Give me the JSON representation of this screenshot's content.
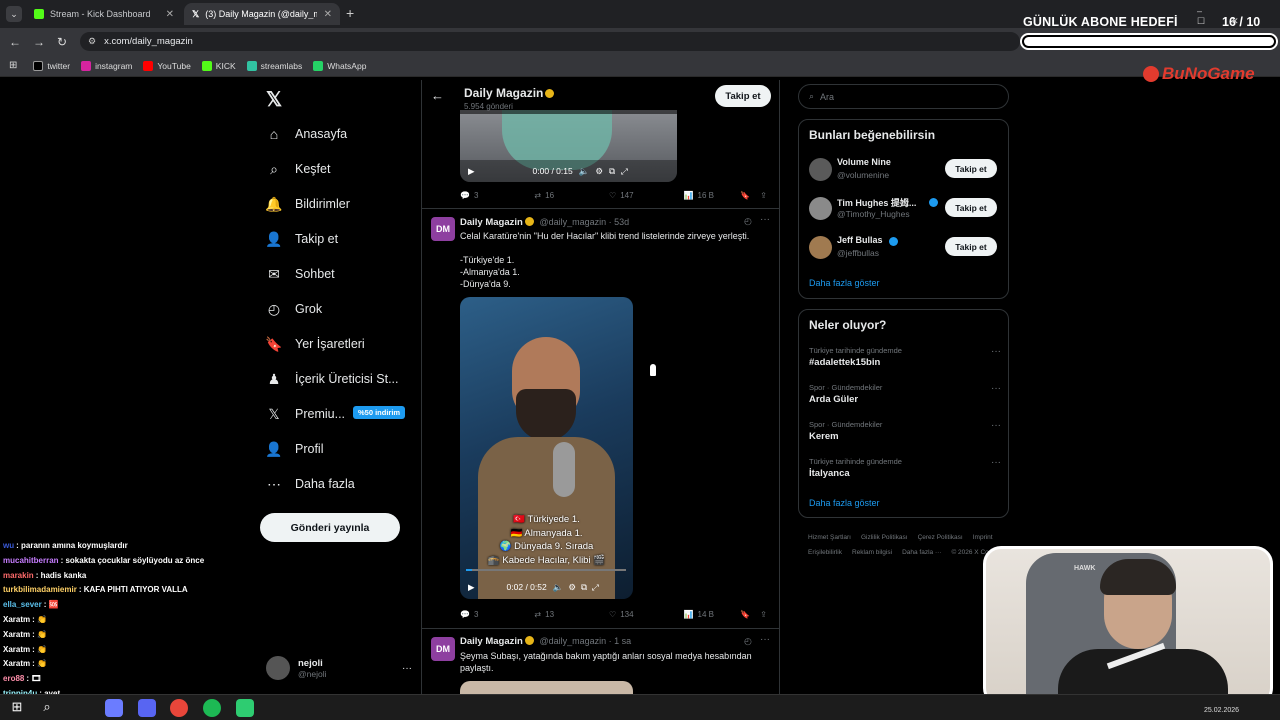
{
  "browser": {
    "tabs": [
      {
        "title": "Stream - Kick Dashboard",
        "close": "✕"
      },
      {
        "title": "(3) Daily Magazin (@daily_mag",
        "close": "✕"
      }
    ],
    "new_tab": "+",
    "url": "x.com/daily_magazin",
    "bookmarks": [
      {
        "label": "twitter",
        "color": "#000000"
      },
      {
        "label": "instagram",
        "color": "#d6249f"
      },
      {
        "label": "YouTube",
        "color": "#ff0000"
      },
      {
        "label": "KICK",
        "color": "#53fc18"
      },
      {
        "label": "streamlabs",
        "color": "#31c3a2"
      },
      {
        "label": "WhatsApp",
        "color": "#25d366"
      }
    ]
  },
  "overlay": {
    "goal_label": "GÜNLÜK ABONE HEDEFİ",
    "goal_current": "16",
    "goal_total": "/ 10",
    "brand": "BuNoGame"
  },
  "nav": {
    "items": [
      {
        "label": "Anasayfa",
        "icon": "home-icon",
        "glyph": "⌂"
      },
      {
        "label": "Keşfet",
        "icon": "search-icon",
        "glyph": "⌕"
      },
      {
        "label": "Bildirimler",
        "icon": "bell-icon",
        "glyph": "🔔"
      },
      {
        "label": "Takip et",
        "icon": "add-user-icon",
        "glyph": "👤"
      },
      {
        "label": "Sohbet",
        "icon": "mail-icon",
        "glyph": "✉"
      },
      {
        "label": "Grok",
        "icon": "grok-icon",
        "glyph": "◴"
      },
      {
        "label": "Yer İşaretleri",
        "icon": "bookmark-icon",
        "glyph": "🔖"
      },
      {
        "label": "İçerik Üreticisi St...",
        "icon": "creator-icon",
        "glyph": "♟"
      },
      {
        "label": "Premiu...",
        "icon": "x-premium-icon",
        "glyph": "𝕏"
      },
      {
        "label": "Profil",
        "icon": "profile-icon",
        "glyph": "👤"
      },
      {
        "label": "Daha fazla",
        "icon": "more-circle-icon",
        "glyph": "⋯"
      }
    ],
    "premium_badge": "%50 indirim",
    "post_button": "Gönderi yayınla",
    "account_name": "nejoli",
    "account_handle": "@nejoli",
    "account_more": "···"
  },
  "header": {
    "name": "Daily Magazin",
    "posts": "5.954 gönderi",
    "follow": "Takip et"
  },
  "tweet1": {
    "time": "0:00 / 0:15",
    "stats": {
      "replies": "3",
      "retweets": "16",
      "likes": "147",
      "views": "16 B"
    }
  },
  "tweet2": {
    "name": "Daily Magazin",
    "handle": "@daily_magazin · 53d",
    "text": "Celal Karatüre'nin \"Hu der Hacılar\" klibi trend listelerinde zirveye yerleşti.",
    "lines": [
      "-Türkiye'de 1.",
      "-Almanya'da 1.",
      "-Dünya'da 9."
    ],
    "video_caption": [
      "🇹🇷 Türkiyede 1.",
      "🇩🇪 Almanyada 1.",
      "🌍 Dünyada 9. Sırada",
      "🕋 Kabede Hacılar, Klibi 🎬"
    ],
    "time": "0:02 / 0:52",
    "stats": {
      "replies": "3",
      "retweets": "13",
      "likes": "134",
      "views": "14 B"
    }
  },
  "tweet3": {
    "name": "Daily Magazin",
    "handle": "@daily_magazin · 1 sa",
    "text": "Şeyma Subaşı, yatağında bakım yaptığı anları sosyal medya hesabından paylaştı."
  },
  "right": {
    "search_placeholder": "Ara",
    "suggest_title": "Bunları beğenebilirsin",
    "suggestions": [
      {
        "name": "Volume Nine",
        "handle": "@volumenine",
        "follow": "Takip et"
      },
      {
        "name": "Tim Hughes 提姆...",
        "handle": "@Timothy_Hughes",
        "follow": "Takip et"
      },
      {
        "name": "Jeff Bullas",
        "handle": "@jeffbullas",
        "follow": "Takip et"
      }
    ],
    "show_more": "Daha fazla göster",
    "trends_title": "Neler oluyor?",
    "trends": [
      {
        "meta": "Türkiye tarihinde gündemde",
        "name": "#adalettek15bin"
      },
      {
        "meta": "Spor · Gündemdekiler",
        "name": "Arda Güler"
      },
      {
        "meta": "Spor · Gündemdekiler",
        "name": "Kerem"
      },
      {
        "meta": "Türkiye tarihinde gündemde",
        "name": "İtalyanca"
      }
    ],
    "trends_more": "Daha fazla göster",
    "footer_links": [
      "Hizmet Şartları",
      "Gizlilik Politikası",
      "Çerez Politikası",
      "Imprint",
      "Erişilebilirlik",
      "Reklam bilgisi",
      "Daha fazla ···",
      "© 2026 X Corp."
    ]
  },
  "chat": [
    {
      "user": "wu",
      "color": "#3a5bd9",
      "msg": ": paranın amına koymuşlardır"
    },
    {
      "user": "mucahitberran",
      "color": "#c77dff",
      "msg": ": sokakta çocuklar söylüyodu az önce"
    },
    {
      "user": "marakin",
      "color": "#ff6b6b",
      "msg": ": hadis kanka"
    },
    {
      "user": "turkbilimadamiemir",
      "color": "#ffd166",
      "msg": ": KAFA PIHTI ATIYOR VALLA"
    },
    {
      "user": "ella_sever",
      "color": "#5bc0eb",
      "msg": ": 🆘"
    },
    {
      "user": "Xaratm",
      "color": "#ffffff",
      "msg": ": 👏"
    },
    {
      "user": "Xaratm",
      "color": "#ffffff",
      "msg": ": 👏"
    },
    {
      "user": "Xaratm",
      "color": "#ffffff",
      "msg": ": 👏"
    },
    {
      "user": "Xaratm",
      "color": "#ffffff",
      "msg": ": 👏"
    },
    {
      "user": "ero88",
      "color": "#ff8fab",
      "msg": ": 🎞"
    },
    {
      "user": "trippin4u",
      "color": "#9bf6ff",
      "msg": ": ayet"
    }
  ],
  "webcam": {
    "chair_brand": "HAWK"
  },
  "taskbar": {
    "date": "25.02.2026"
  }
}
